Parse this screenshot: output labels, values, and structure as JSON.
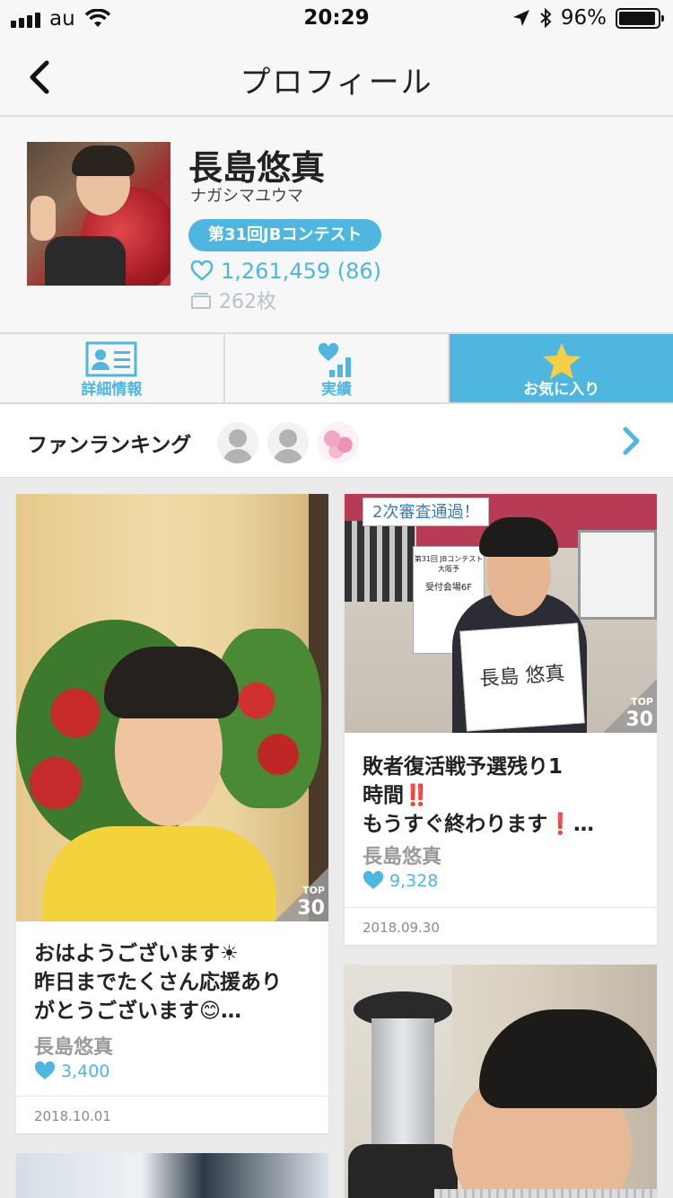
{
  "status_bar": {
    "carrier": "au",
    "time": "20:29",
    "battery": "96%",
    "battery_level": 0.96
  },
  "nav": {
    "title": "プロフィール"
  },
  "profile": {
    "name": "長島悠真",
    "kana": "ナガシマユウマ",
    "contest": "第31回JBコンテスト",
    "likes": "1,261,459 (86)",
    "photos": "262枚"
  },
  "tabs": [
    {
      "label": "詳細情報",
      "icon": "id-card-icon",
      "active": false
    },
    {
      "label": "実績",
      "icon": "heart-bars-icon",
      "active": false
    },
    {
      "label": "お気に入り",
      "icon": "star-icon",
      "active": true
    }
  ],
  "fan_ranking": {
    "label": "ファンランキング"
  },
  "posts": [
    {
      "text_line1": "おはようございます☀",
      "text_line2": "昨日までたくさん応援あり",
      "text_line3": "がとうございます😊…",
      "author": "長島悠真",
      "likes": "3,400",
      "date": "2018.10.01",
      "badge_top": "TOP",
      "badge_rank": "30"
    },
    {
      "text_line1": "敗者復活戦予選残り1",
      "text_line2": "時間‼️",
      "text_line3": "もうすぐ終わります❗…",
      "author": "長島悠真",
      "likes": "9,328",
      "date": "2018.09.30",
      "badge_top": "TOP",
      "badge_rank": "30",
      "photo_caption": "2次審査通過！",
      "sign_text": "長島 悠真",
      "sign_label": "第31回 JBコンテスト大阪予",
      "sign_sub": "受付会場6F"
    }
  ],
  "colors": {
    "accent": "#4fb6e0",
    "muted": "#9a9a9a"
  }
}
